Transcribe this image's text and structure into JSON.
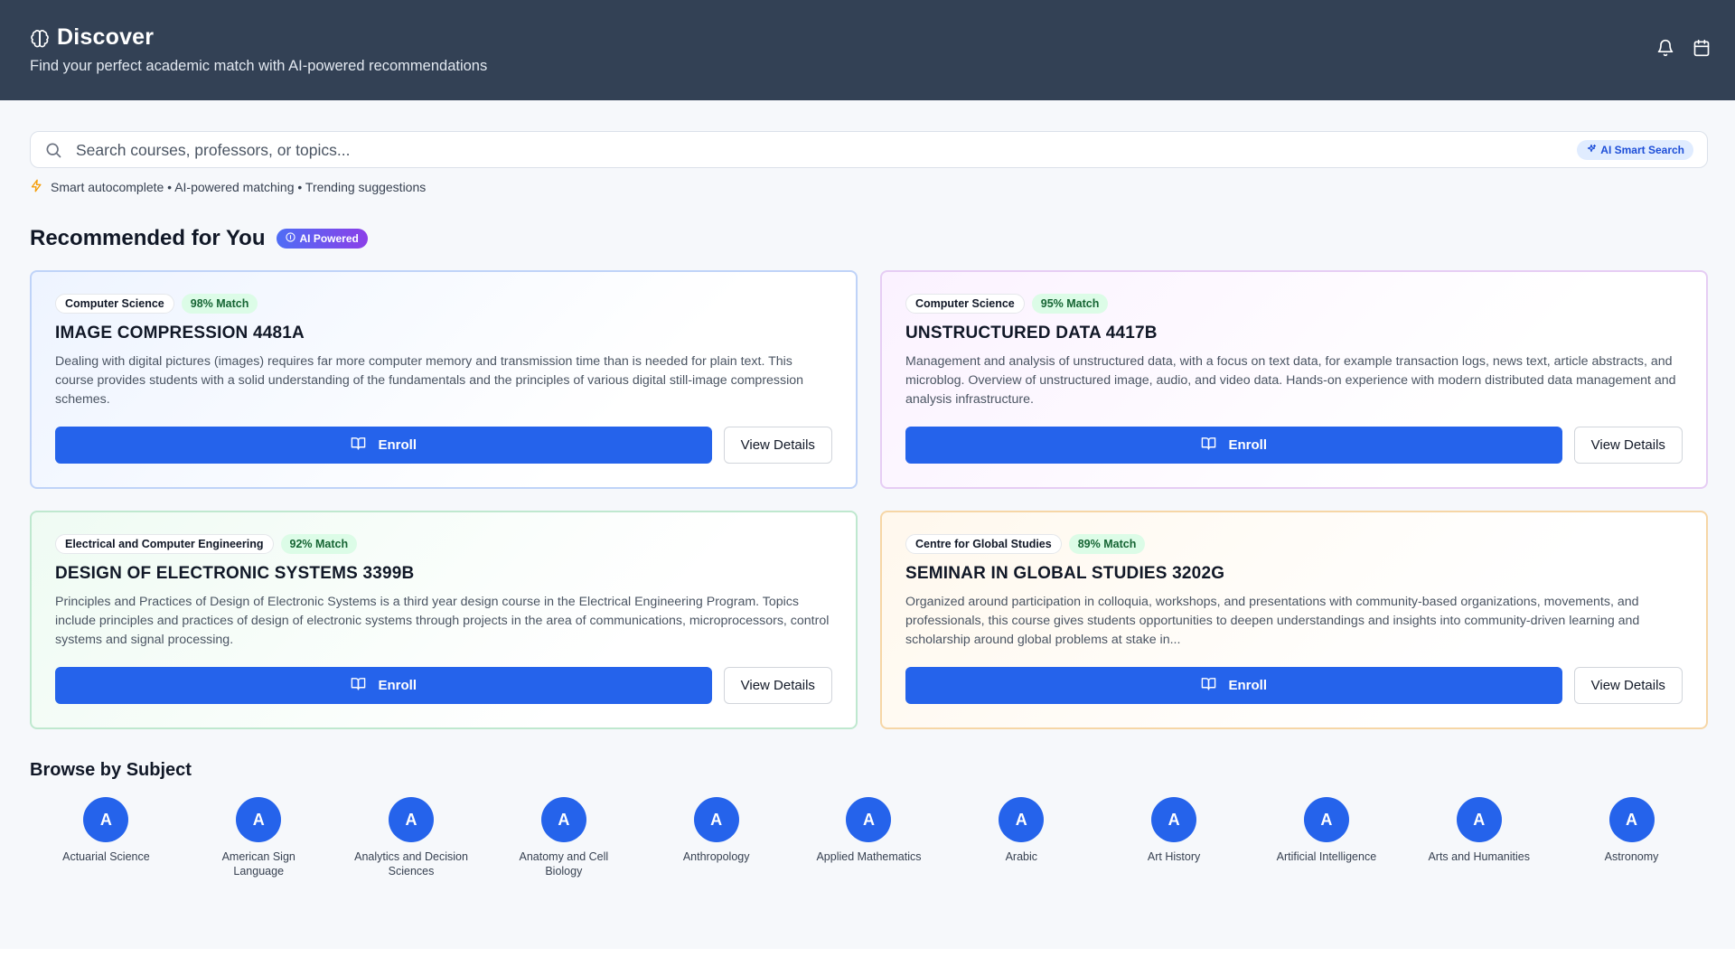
{
  "header": {
    "title": "Discover",
    "subtitle": "Find your perfect academic match with AI-powered recommendations",
    "icons": [
      "brain-icon",
      "bell-icon",
      "calendar-icon"
    ]
  },
  "search": {
    "placeholder": "Search courses, professors, or topics...",
    "value": "",
    "ai_button": "AI Smart Search",
    "hint": "Smart autocomplete • AI-powered matching • Trending suggestions"
  },
  "recommended": {
    "title": "Recommended for You",
    "badge": "AI Powered",
    "cards": [
      {
        "department": "Computer Science",
        "match": "98% Match",
        "title": "IMAGE COMPRESSION 4481A",
        "description": "Dealing with digital pictures (images) requires far more computer memory and transmission time than is needed for plain text. This course provides students with a solid understanding of the fundamentals and the principles of various digital still-image compression schemes.",
        "enroll": "Enroll",
        "details": "View Details"
      },
      {
        "department": "Computer Science",
        "match": "95% Match",
        "title": "UNSTRUCTURED DATA 4417B",
        "description": "Management and analysis of unstructured data, with a focus on text data, for example transaction logs, news text, article abstracts, and microblog. Overview of unstructured image, audio, and video data. Hands-on experience with modern distributed data management and analysis infrastructure.",
        "enroll": "Enroll",
        "details": "View Details"
      },
      {
        "department": "Electrical and Computer Engineering",
        "match": "92% Match",
        "title": "DESIGN OF ELECTRONIC SYSTEMS 3399B",
        "description": "Principles and Practices of Design of Electronic Systems is a third year design course in the Electrical Engineering Program. Topics include principles and practices of design of electronic systems through projects in the area of communications, microprocessors, control systems and signal processing.",
        "enroll": "Enroll",
        "details": "View Details"
      },
      {
        "department": "Centre for Global Studies",
        "match": "89% Match",
        "title": "SEMINAR IN GLOBAL STUDIES 3202G",
        "description": "Organized around participation in colloquia, workshops, and presentations with community-based organizations, movements, and professionals, this course gives students opportunities to deepen understandings and insights into community-driven learning and scholarship around global problems at stake in...",
        "enroll": "Enroll",
        "details": "View Details"
      }
    ]
  },
  "browse": {
    "title": "Browse by Subject",
    "subjects": [
      {
        "initial": "A",
        "label": "Actuarial Science"
      },
      {
        "initial": "A",
        "label": "American Sign Language"
      },
      {
        "initial": "A",
        "label": "Analytics and Decision Sciences"
      },
      {
        "initial": "A",
        "label": "Anatomy and Cell Biology"
      },
      {
        "initial": "A",
        "label": "Anthropology"
      },
      {
        "initial": "A",
        "label": "Applied Mathematics"
      },
      {
        "initial": "A",
        "label": "Arabic"
      },
      {
        "initial": "A",
        "label": "Art History"
      },
      {
        "initial": "A",
        "label": "Artificial Intelligence"
      },
      {
        "initial": "A",
        "label": "Arts and Humanities"
      },
      {
        "initial": "A",
        "label": "Astronomy"
      }
    ]
  },
  "colors": {
    "header_bg": "#334155",
    "primary": "#2563eb",
    "match_bg": "#dcfce7",
    "match_text": "#166534",
    "hint_icon": "#f59e0b"
  }
}
